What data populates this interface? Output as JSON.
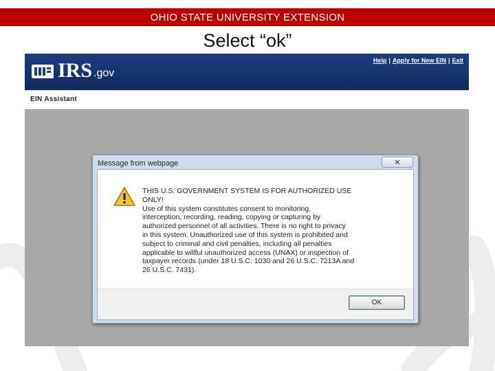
{
  "banner": {
    "title": "OHIO STATE UNIVERSITY EXTENSION"
  },
  "slide": {
    "title": "Select “ok”"
  },
  "irs": {
    "logo_text": "IRS",
    "logo_suffix": ".gov",
    "links": [
      "Help",
      "Apply for New EIN",
      "Exit"
    ],
    "app_title": "EIN Assistant",
    "header_color": "#1d3f7f"
  },
  "dialog": {
    "title": "Message from webpage",
    "close_icon": "close-x-icon",
    "warning_icon": "warning-triangle-icon",
    "message_lines": [
      "THIS U.S. GOVERNMENT SYSTEM IS FOR AUTHORIZED USE",
      "ONLY!",
      "Use of this system constitutes consent to monitoring,",
      "interception, recording, reading, copying or capturing by",
      "authorized personnel of all activities. There is no right to privacy",
      "in this system. Unauthorized use of this system is prohibited and",
      "subject to criminal and civil penalties, including all penalties",
      "applicable to willful unauthorized access (UNAX) or inspection of",
      "taxpayer records (under 18 U.S.C. 1030 and 26 U.S.C. 7213A and",
      "26 U.S.C. 7431)."
    ],
    "ok_label": "OK"
  },
  "colors": {
    "banner": "#bb0000",
    "background_gray": "#a9a9a9"
  }
}
